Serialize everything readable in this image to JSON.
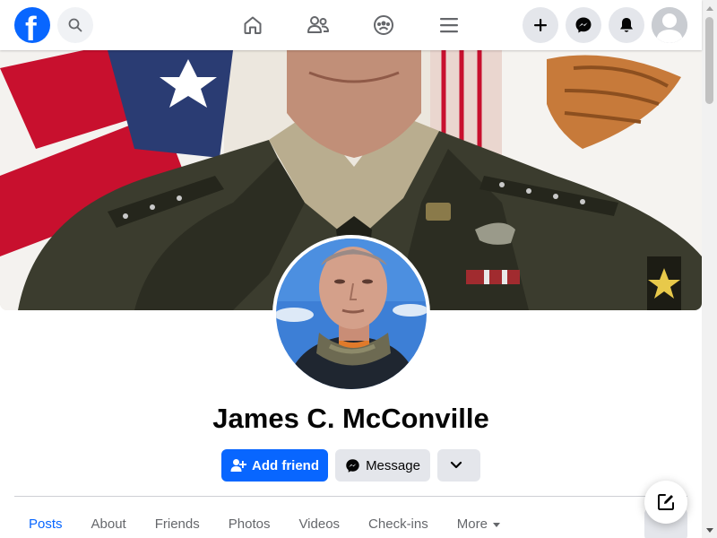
{
  "topbar": {
    "logo_letter": "f",
    "icons": {
      "logo": "facebook-logo",
      "search": "search-icon",
      "home": "home-icon",
      "friends": "friends-icon",
      "groups": "groups-icon",
      "menu": "menu-icon",
      "create": "plus-icon",
      "messenger": "messenger-icon",
      "notifications": "bell-icon",
      "account": "avatar"
    }
  },
  "profile": {
    "name": "James C. McConville"
  },
  "actions": {
    "add_friend_label": "Add friend",
    "message_label": "Message"
  },
  "tabs": [
    {
      "label": "Posts",
      "active": true
    },
    {
      "label": "About",
      "active": false
    },
    {
      "label": "Friends",
      "active": false
    },
    {
      "label": "Photos",
      "active": false
    },
    {
      "label": "Videos",
      "active": false
    },
    {
      "label": "Check-ins",
      "active": false
    },
    {
      "label": "More",
      "active": false
    }
  ],
  "colors": {
    "brand": "#0866ff",
    "button_gray": "#e4e6eb",
    "text_secondary": "#65676b"
  }
}
